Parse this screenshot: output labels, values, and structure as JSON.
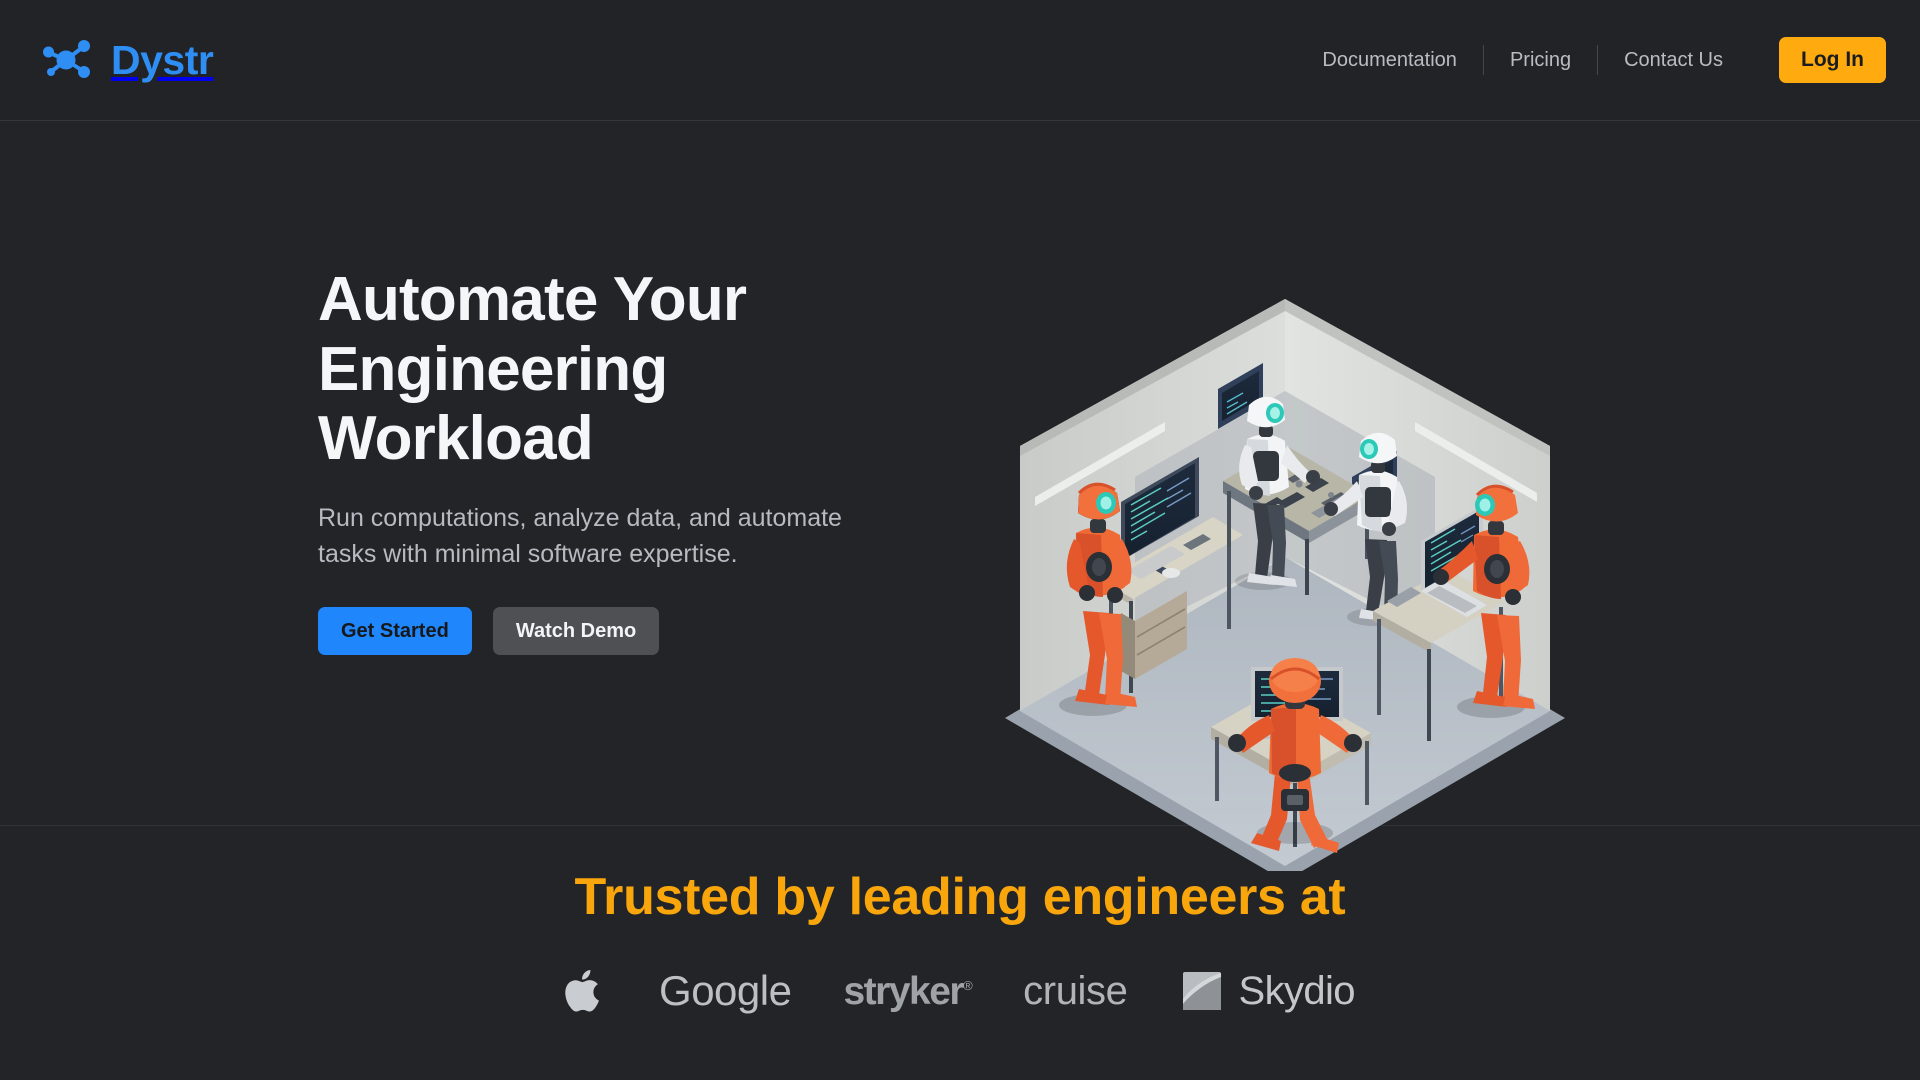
{
  "brand": {
    "name": "Dystr",
    "logo_icon": "network-nodes-icon",
    "color": "#2f8ef4"
  },
  "header": {
    "nav": [
      {
        "label": "Documentation"
      },
      {
        "label": "Pricing"
      },
      {
        "label": "Contact Us"
      }
    ],
    "login_label": "Log In",
    "login_color": "#ffab10"
  },
  "hero": {
    "title": "Automate Your Engineering Workload",
    "subtitle": "Run computations, analyze data, and automate tasks with minimal software expertise.",
    "primary_cta": "Get Started",
    "secondary_cta": "Watch Demo",
    "primary_color": "#1f87fb",
    "secondary_color": "#4e5054",
    "illustration": "isometric-robot-office-illustration"
  },
  "trusted": {
    "title": "Trusted by leading engineers at",
    "title_color": "#f9a60c",
    "logos": [
      {
        "name": "Apple",
        "type": "icon"
      },
      {
        "name": "Google",
        "type": "wordmark"
      },
      {
        "name": "stryker",
        "type": "wordmark",
        "superscript": "®"
      },
      {
        "name": "cruise",
        "type": "wordmark"
      },
      {
        "name": "Skydio",
        "type": "wordmark-with-mark"
      }
    ]
  }
}
